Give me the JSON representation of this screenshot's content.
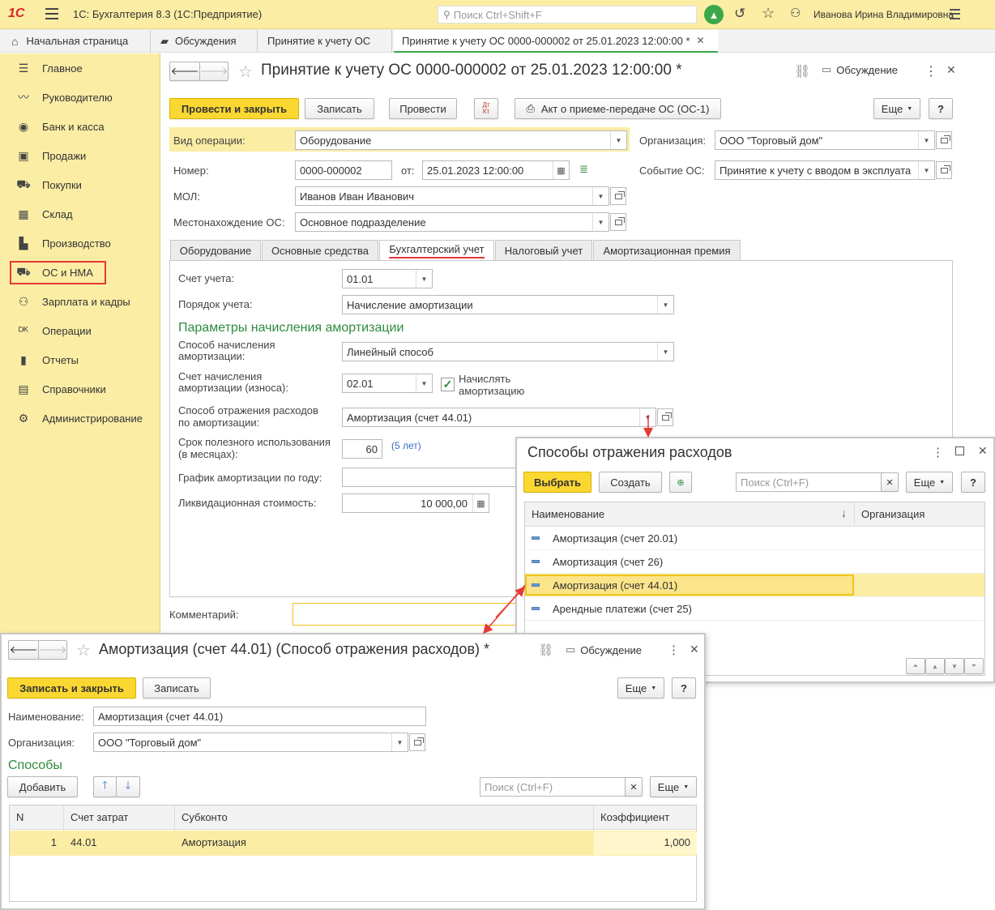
{
  "app": {
    "title": "1С: Бухгалтерия 8.3  (1С:Предприятие)",
    "search_placeholder": "Поиск Ctrl+Shift+F",
    "user": "Иванова Ирина Владимировна"
  },
  "tabs": [
    "Начальная страница",
    "Обсуждения",
    "Принятие к учету ОС",
    "Принятие к учету ОС 0000-000002 от 25.01.2023 12:00:00 *"
  ],
  "sidebar": {
    "items": [
      {
        "label": "Главное",
        "icon": "menu-icon"
      },
      {
        "label": "Руководителю",
        "icon": "chart-icon"
      },
      {
        "label": "Банк и касса",
        "icon": "coin-icon"
      },
      {
        "label": "Продажи",
        "icon": "bag-icon"
      },
      {
        "label": "Покупки",
        "icon": "cart-icon"
      },
      {
        "label": "Склад",
        "icon": "warehouse-icon"
      },
      {
        "label": "Производство",
        "icon": "factory-icon"
      },
      {
        "label": "ОС и НМА",
        "icon": "truck-icon"
      },
      {
        "label": "Зарплата и кадры",
        "icon": "people-icon"
      },
      {
        "label": "Операции",
        "icon": "dt-kt-icon"
      },
      {
        "label": "Отчеты",
        "icon": "report-icon"
      },
      {
        "label": "Справочники",
        "icon": "book-icon"
      },
      {
        "label": "Администрирование",
        "icon": "gear-icon"
      }
    ]
  },
  "doc": {
    "title": "Принятие к учету ОС 0000-000002 от 25.01.2023 12:00:00 *",
    "discussion": "Обсуждение",
    "btn_post_close": "Провести и закрыть",
    "btn_save": "Записать",
    "btn_post": "Провести",
    "btn_act": "Акт о приеме-передаче ОС (ОС-1)",
    "btn_more": "Еще",
    "btn_help": "?",
    "dt_kt": "Дт Кт",
    "op_label": "Вид операции:",
    "op_value": "Оборудование",
    "org_label": "Организация:",
    "org_value": "ООО \"Торговый дом\"",
    "num_label": "Номер:",
    "num_value": "0000-000002",
    "from_label": "от:",
    "date_value": "25.01.2023 12:00:00",
    "event_label": "Событие ОС:",
    "event_value": "Принятие к учету с вводом в эксплуата",
    "mol_label": "МОЛ:",
    "mol_value": "Иванов Иван Иванович",
    "loc_label": "Местонахождение ОС:",
    "loc_value": "Основное подразделение",
    "tabs": [
      "Оборудование",
      "Основные средства",
      "Бухгалтерский учет",
      "Налоговый учет",
      "Амортизационная премия"
    ],
    "account_label": "Счет учета:",
    "account_value": "01.01",
    "order_label": "Порядок учета:",
    "order_value": "Начисление амортизации",
    "params_header": "Параметры начисления амортизации",
    "method_label1": "Способ начисления",
    "method_label2": "амортизации:",
    "method_value": "Линейный способ",
    "deprec_label1": "Счет начисления",
    "deprec_label2": "амортизации (износа):",
    "deprec_value": "02.01",
    "accrue_label1": "Начислять",
    "accrue_label2": "амортизацию",
    "expense_label1": "Способ отражения расходов",
    "expense_label2": "по амортизации:",
    "expense_value": "Амортизация (счет 44.01)",
    "term_label1": "Срок полезного использования",
    "term_label2": "(в месяцах):",
    "term_value": "60",
    "term_years": "(5 лет)",
    "schedule_label": "График амортизации по году:",
    "liquid_label": "Ликвидационная стоимость:",
    "liquid_value": "10 000,00",
    "comment_label": "Комментарий:"
  },
  "popup": {
    "title": "Способы отражения расходов",
    "btn_select": "Выбрать",
    "btn_create": "Создать",
    "search_placeholder": "Поиск (Ctrl+F)",
    "btn_more": "Еще",
    "btn_help": "?",
    "col_name": "Наименование",
    "col_org": "Организация",
    "rows": [
      "Амортизация (счет 20.01)",
      "Амортизация (счет 26)",
      "Амортизация (счет 44.01)",
      "Арендные платежи (счет 25)"
    ]
  },
  "form": {
    "title": "Амортизация (счет 44.01) (Способ отражения расходов) *",
    "discussion": "Обсуждение",
    "btn_save_close": "Записать и закрыть",
    "btn_save": "Записать",
    "btn_more": "Еще",
    "btn_help": "?",
    "name_label": "Наименование:",
    "name_value": "Амортизация (счет 44.01)",
    "org_label": "Организация:",
    "org_value": "ООО \"Торговый дом\"",
    "section": "Способы",
    "btn_add": "Добавить",
    "search_placeholder": "Поиск (Ctrl+F)",
    "more": "Еще",
    "cols": [
      "N",
      "Счет затрат",
      "Субконто",
      "Коэффициент"
    ],
    "row": {
      "n": "1",
      "account": "44.01",
      "subconto": "Амортизация",
      "coef": "1,000"
    }
  },
  "colors": {
    "accent_yellow": "#fbd731",
    "sidebar_bg": "#fbeda4",
    "highlight_red": "#e53935",
    "header_bg": "#fbeda4",
    "green_text": "#2e8b3d"
  }
}
